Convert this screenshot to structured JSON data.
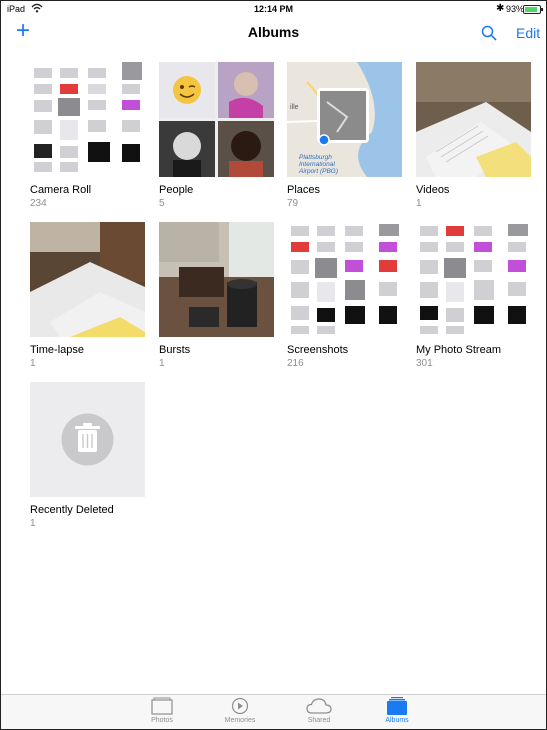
{
  "status": {
    "carrier": "iPad",
    "time": "12:14 PM",
    "battery": "93%",
    "battery_level": 0.93
  },
  "nav": {
    "add_label": "+",
    "title": "Albums",
    "edit_label": "Edit"
  },
  "albums": [
    {
      "name": "Camera Roll",
      "count": "234"
    },
    {
      "name": "People",
      "count": "5"
    },
    {
      "name": "Places",
      "count": "79"
    },
    {
      "name": "Videos",
      "count": "1"
    },
    {
      "name": "Time-lapse",
      "count": "1"
    },
    {
      "name": "Bursts",
      "count": "1"
    },
    {
      "name": "Screenshots",
      "count": "216"
    },
    {
      "name": "My Photo Stream",
      "count": "301"
    },
    {
      "name": "Recently Deleted",
      "count": "1"
    }
  ],
  "places_map_text": "Plattsburgh International Airport (PBG)",
  "places_map_fragment": "ille",
  "tabs": [
    {
      "label": "Photos",
      "icon": "photos-icon"
    },
    {
      "label": "Memories",
      "icon": "memories-icon"
    },
    {
      "label": "Shared",
      "icon": "cloud-icon"
    },
    {
      "label": "Albums",
      "icon": "albums-icon",
      "active": true
    }
  ],
  "colors": {
    "accent": "#1a7af0",
    "battery": "#4cd964",
    "secondary_text": "#8e8e93"
  }
}
